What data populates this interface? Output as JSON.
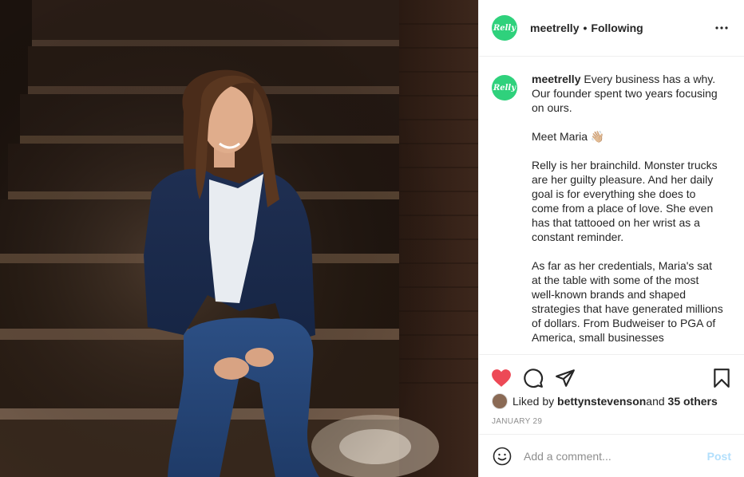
{
  "post": {
    "username": "meetrelly",
    "avatar_text": "Relly",
    "follow_separator": "•",
    "follow_status": "Following",
    "caption_paragraphs": [
      "Every business has a why. Our founder spent two years focusing on ours.",
      "Meet Maria 👋🏼",
      "Relly is her brainchild. Monster trucks are her guilty pleasure. And her daily goal is for everything she does to come from a place of love. She even has that tattooed on her wrist as a constant reminder.",
      "As far as her credentials, Maria's sat at the table with some of the most well-known brands and shaped strategies that have generated millions of dollars. From Budweiser to PGA of America, small businesses"
    ],
    "liked_by_prefix": "Liked by ",
    "liked_by_user": "bettynstevenson",
    "liked_by_and": " and ",
    "liked_by_others": "35 others",
    "date": "JANUARY 29"
  },
  "comment": {
    "placeholder": "Add a comment...",
    "post_label": "Post"
  },
  "colors": {
    "brand_green": "#2fd17c",
    "like_red": "#ed4956",
    "post_disabled": "#b2dffc"
  },
  "icons": {
    "more": "more-horizontal-icon",
    "like": "heart-filled-icon",
    "comment": "comment-bubble-icon",
    "share": "paper-plane-icon",
    "save": "bookmark-icon",
    "emoji": "smiley-icon"
  }
}
